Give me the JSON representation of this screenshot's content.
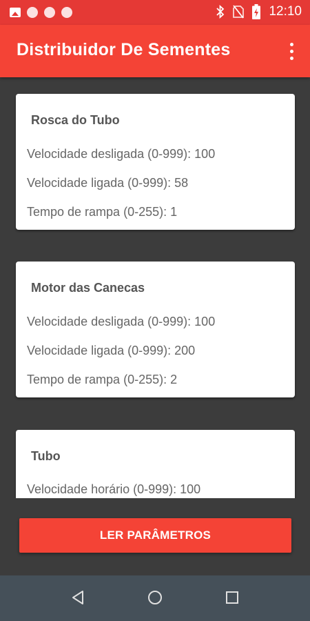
{
  "status_bar": {
    "time": "12:10",
    "icons": [
      "image-icon",
      "circle-icon",
      "circle-icon",
      "circle-icon",
      "bluetooth-icon",
      "no-sim-icon",
      "battery-charging-icon"
    ]
  },
  "app_bar": {
    "title": "Distribuidor De Sementes",
    "menu_icon": "more-vert-icon"
  },
  "cards": [
    {
      "title": "Rosca do Tubo",
      "rows": [
        "Velocidade desligada (0-999): 100",
        "Velocidade ligada (0-999): 58",
        "Tempo de rampa (0-255): 1"
      ]
    },
    {
      "title": "Motor das Canecas",
      "rows": [
        "Velocidade desligada (0-999): 100",
        "Velocidade ligada (0-999): 200",
        "Tempo de rampa (0-255): 2"
      ]
    },
    {
      "title": "Tubo",
      "rows": [
        "Velocidade horário (0-999): 100"
      ]
    }
  ],
  "read_button": {
    "label": "LER PARÂMETROS"
  },
  "nav_bar": {
    "icons": [
      "back-icon",
      "home-icon",
      "recents-icon"
    ]
  },
  "colors": {
    "primary": "#f44336",
    "primary_dark": "#e53935",
    "background": "#3c3c3c",
    "nav_bar": "#455059"
  }
}
